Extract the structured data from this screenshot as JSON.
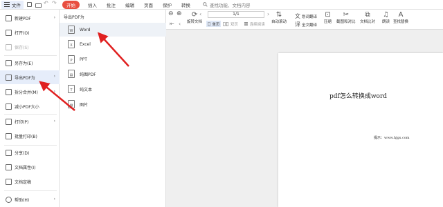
{
  "topbar": {
    "file_label": "文件",
    "tabs": [
      "开始",
      "插入",
      "批注",
      "编辑",
      "页面",
      "保护",
      "转换"
    ],
    "search_placeholder": "查找功能、文档内容"
  },
  "toolbar": {
    "page_indicator": "1/1",
    "rotate_label": "旋转文档",
    "single_page_label": "单页",
    "dual_page_label": "双页",
    "continuous_label": "连续阅读",
    "auto_scroll_label": "自动滚动",
    "translate_label": "划词翻译",
    "full_translate_label": "全文翻译",
    "compress_label": "压缩",
    "screenshot_label": "截图和对比",
    "compare_label": "文档比对",
    "read_label": "朗读",
    "find_replace_label": "查找替换"
  },
  "menu": {
    "items": [
      {
        "label": "新建PDF"
      },
      {
        "label": "打开(O)"
      },
      {
        "label": "保存(S)"
      },
      {
        "label": "另存为(E)"
      },
      {
        "label": "导出PDF为"
      },
      {
        "label": "拆分合并(M)"
      },
      {
        "label": "减小PDF大小"
      },
      {
        "label": "打印(P)"
      },
      {
        "label": "批量打印(B)"
      },
      {
        "label": "分享(D)"
      },
      {
        "label": "文档属性(I)"
      },
      {
        "label": "文档定稿"
      },
      {
        "label": "帮助(H)"
      }
    ]
  },
  "submenu": {
    "title": "导出PDF为",
    "items": [
      {
        "label": "Word"
      },
      {
        "label": "Excel"
      },
      {
        "label": "PPT"
      },
      {
        "label": "纯图PDF"
      },
      {
        "label": "纯文本"
      },
      {
        "label": "图片"
      }
    ]
  },
  "document": {
    "heading": "pdf怎么转换成word",
    "note": "提示：www.hjgs.com"
  },
  "colors": {
    "accent_red": "#e84e40",
    "selected_bg": "#e6edfa"
  }
}
